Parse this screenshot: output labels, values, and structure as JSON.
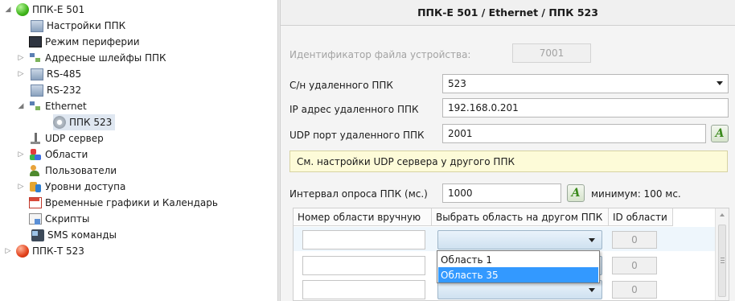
{
  "tree": {
    "items": [
      {
        "label": "ППК-Е 501",
        "icon": "status-green-icon",
        "expand": "expanded"
      },
      {
        "label": "Настройки ППК",
        "icon": "settings-doc-icon",
        "expand": "none"
      },
      {
        "label": "Режим периферии",
        "icon": "monitor-icon",
        "expand": "none"
      },
      {
        "label": "Адресные шлейфы ППК",
        "icon": "address-loops-icon",
        "expand": "collapsed"
      },
      {
        "label": "RS-485",
        "icon": "rs485-icon",
        "expand": "collapsed"
      },
      {
        "label": "RS-232",
        "icon": "rs232-icon",
        "expand": "none"
      },
      {
        "label": "Ethernet",
        "icon": "ethernet-icon",
        "expand": "expanded"
      },
      {
        "label": "ППК 523",
        "icon": "gear-icon",
        "expand": "none"
      },
      {
        "label": "UDP сервер",
        "icon": "plug-icon",
        "expand": "none"
      },
      {
        "label": "Области",
        "icon": "areas-icon",
        "expand": "collapsed"
      },
      {
        "label": "Пользователи",
        "icon": "users-icon",
        "expand": "none"
      },
      {
        "label": "Уровни доступа",
        "icon": "access-levels-icon",
        "expand": "collapsed"
      },
      {
        "label": "Временные графики и Календарь",
        "icon": "calendar-icon",
        "expand": "none"
      },
      {
        "label": "Скрипты",
        "icon": "scripts-icon",
        "expand": "none"
      },
      {
        "label": "SMS команды",
        "icon": "phone-icon",
        "expand": "none"
      },
      {
        "label": "ППК-Т 523",
        "icon": "status-red-icon",
        "expand": "collapsed"
      }
    ]
  },
  "panel": {
    "title": "ППК-Е 501 / Ethernet / ППК 523",
    "device_file_id": {
      "label": "Идентификатор файла устройства:",
      "value": "7001"
    },
    "remote_serial": {
      "label": "С/н удаленного ППК",
      "value": "523"
    },
    "remote_ip": {
      "label": "IP адрес удаленного ППК",
      "value": "192.168.0.201"
    },
    "remote_udp_port": {
      "label": "UDP порт удаленного ППК",
      "value": "2001"
    },
    "note": "См. настройки UDP сервера у другого ППК",
    "poll_interval": {
      "label": "Интервал опроса ППК (мс.)",
      "value": "1000",
      "min_text": "минимум: 100 мс."
    },
    "auto_button_glyph": "A",
    "grid": {
      "headers": [
        "Номер области вручную",
        "Выбрать область на другом ППК",
        "ID области"
      ],
      "rows": [
        {
          "manual": "",
          "id": "0"
        },
        {
          "manual": "",
          "id": "0"
        },
        {
          "manual": "",
          "id": "0"
        }
      ]
    },
    "dropdown": {
      "options": [
        "Область 1",
        "Область 35"
      ],
      "highlighted_index": 1
    }
  }
}
